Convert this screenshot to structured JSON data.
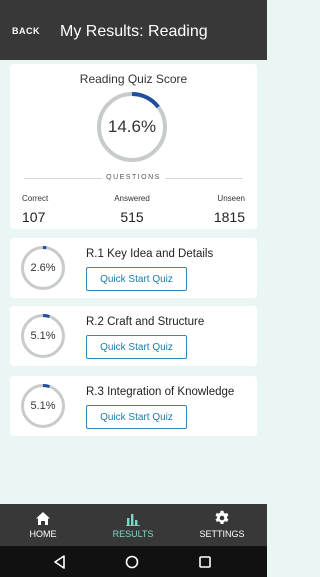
{
  "header": {
    "back_label": "BACK",
    "title": "My Results: Reading"
  },
  "score": {
    "title": "Reading Quiz Score",
    "percent_label": "14.6%",
    "percent": 14.6,
    "questions_label": "QUESTIONS",
    "stats": [
      {
        "label": "Correct",
        "value": "107"
      },
      {
        "label": "Answered",
        "value": "515"
      },
      {
        "label": "Unseen",
        "value": "1815"
      }
    ]
  },
  "skills": [
    {
      "name": "R.1 Key Idea and Details",
      "percent_label": "2.6%",
      "percent": 2.6,
      "button_label": "Quick Start Quiz"
    },
    {
      "name": "R.2 Craft and Structure",
      "percent_label": "5.1%",
      "percent": 5.1,
      "button_label": "Quick Start Quiz"
    },
    {
      "name": "R.3 Integration of Knowledge",
      "percent_label": "5.1%",
      "percent": 5.1,
      "button_label": "Quick Start Quiz"
    }
  ],
  "nav": {
    "home_label": "HOME",
    "results_label": "RESULTS",
    "settings_label": "SETTINGS",
    "active": "results"
  },
  "colors": {
    "accent": "#1f4f9e",
    "ring_track": "#c8cbcb",
    "active_nav": "#7fd6c3",
    "button_border": "#2e8ab5"
  },
  "icons": {
    "home": "home-icon",
    "results": "bar-chart-icon",
    "settings": "gear-icon",
    "sys_back": "triangle-back-icon",
    "sys_home": "circle-home-icon",
    "sys_recent": "square-recent-icon"
  }
}
